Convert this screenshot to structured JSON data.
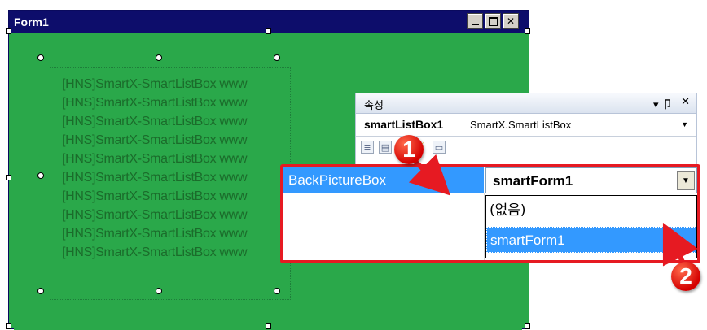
{
  "form": {
    "title": "Form1",
    "background_color": "#2aa84a",
    "titlebar_color": "#0d0d6b",
    "buttons": {
      "minimize": "minimize-icon",
      "maximize": "maximize-icon",
      "close_label": "✕"
    }
  },
  "listbox": {
    "items": [
      "[HNS]SmartX-SmartListBox www",
      "[HNS]SmartX-SmartListBox www",
      "[HNS]SmartX-SmartListBox www",
      "[HNS]SmartX-SmartListBox www",
      "[HNS]SmartX-SmartListBox www",
      "[HNS]SmartX-SmartListBox www",
      "[HNS]SmartX-SmartListBox www",
      "[HNS]SmartX-SmartListBox www",
      "[HNS]SmartX-SmartListBox www",
      "[HNS]SmartX-SmartListBox www"
    ]
  },
  "properties": {
    "title": "속성",
    "pin_label": "▾ 卩",
    "close_label": "✕",
    "object_name": "smartListBox1",
    "object_type": "SmartX.SmartListBox",
    "property_name": "BackPictureBox",
    "property_value": "smartForm1",
    "options": [
      "(없음)",
      "smartForm1"
    ],
    "selected_option": "smartForm1"
  },
  "callouts": {
    "step1": "1",
    "step2": "2",
    "color": "#e61a22"
  }
}
